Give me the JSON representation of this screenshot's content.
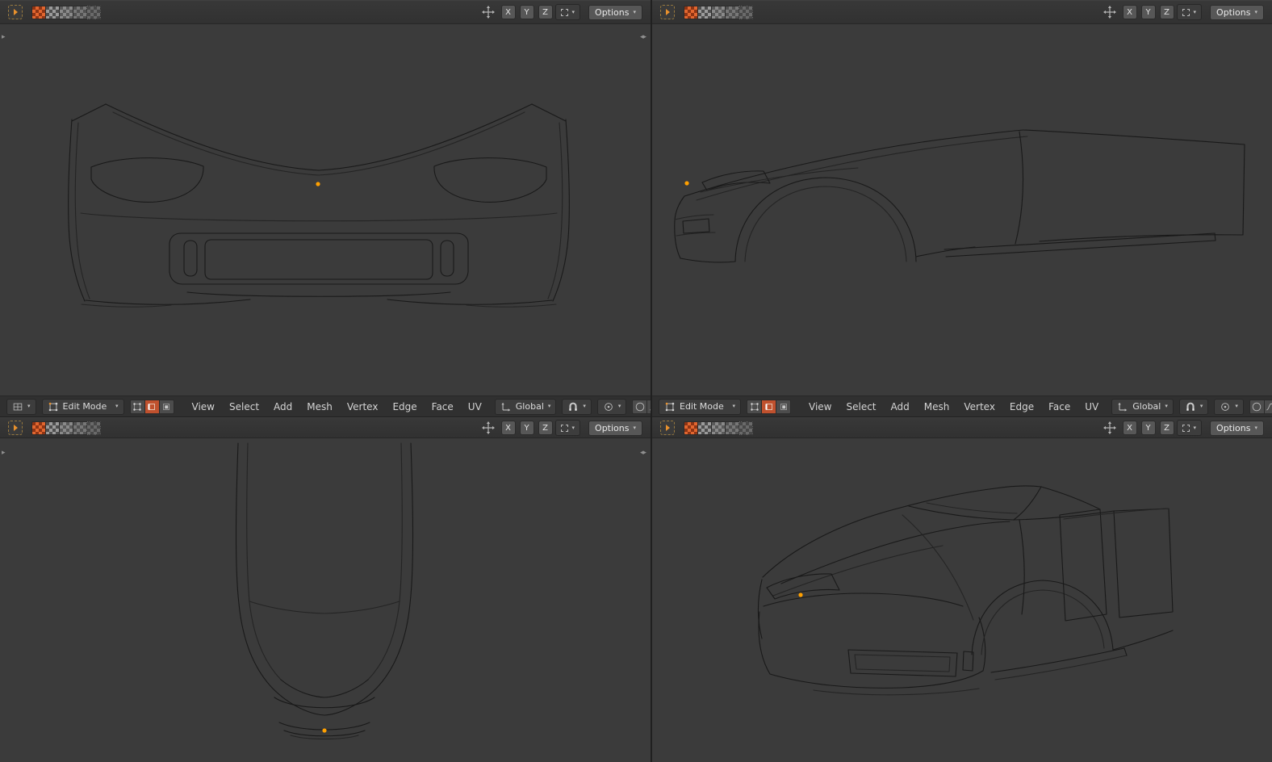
{
  "colors": {
    "viewport_bg": "#3b3b3b",
    "header_bg": "#383838",
    "menubar_bg": "#303030",
    "button_bg": "#575757",
    "accent_orange": "#e8912d",
    "select_orange": "#c0512e",
    "wire": "#191919",
    "origin_dot": "#ffa000"
  },
  "header": {
    "x": "X",
    "y": "Y",
    "z": "Z",
    "options": "Options"
  },
  "menubar": {
    "mode": "Edit Mode",
    "menus": [
      "View",
      "Select",
      "Add",
      "Mesh",
      "Vertex",
      "Edge",
      "Face",
      "UV"
    ],
    "orientation": "Global"
  }
}
